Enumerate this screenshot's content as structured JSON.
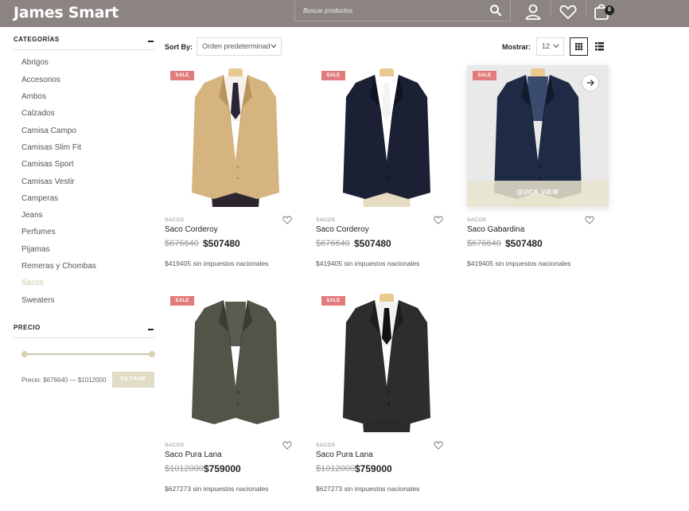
{
  "header": {
    "logo": "James Smart",
    "search_placeholder": "Buscar productos",
    "cart_count": "0"
  },
  "sidebar": {
    "categories_title": "CATEGORÍAS",
    "categories": [
      {
        "label": "Abrigos"
      },
      {
        "label": "Accesorios"
      },
      {
        "label": "Ambos"
      },
      {
        "label": "Calzados"
      },
      {
        "label": "Camisa Campo"
      },
      {
        "label": "Camisas Slim Fit"
      },
      {
        "label": "Camisas Sport"
      },
      {
        "label": "Camisas Vestir"
      },
      {
        "label": "Camperas"
      },
      {
        "label": "Jeans"
      },
      {
        "label": "Perfumes"
      },
      {
        "label": "Pijamas"
      },
      {
        "label": "Remeras y Chombas"
      },
      {
        "label": "Sacos",
        "active": true
      },
      {
        "label": "Sweaters"
      }
    ],
    "price_title": "PRECIO",
    "price_range": "Precio: $676640 — $1012000",
    "filter_label": "FILTRAR",
    "slider_min": 0,
    "slider_max": 1
  },
  "toolbar": {
    "sort_label": "Sort By:",
    "sort_value": "Orden predeterminado",
    "show_label": "Mostrar:",
    "show_value": "12"
  },
  "products": [
    {
      "badge": "SALE",
      "category": "SACOS",
      "name": "Saco Corderoy",
      "old_price": "$676640",
      "price": "$507480",
      "tax_note": "$419405 sin impuestos nacionales",
      "style": "tan"
    },
    {
      "badge": "SALE",
      "category": "SACOS",
      "name": "Saco Corderoy",
      "old_price": "$676640",
      "price": "$507480",
      "tax_note": "$419405 sin impuestos nacionales",
      "style": "navy"
    },
    {
      "badge": "SALE",
      "category": "SACOS",
      "name": "Saco Gabardina",
      "old_price": "$676640",
      "price": "$507480",
      "tax_note": "$419405 sin impuestos nacionales",
      "style": "navy2",
      "quick_view": "QUICK VIEW"
    },
    {
      "badge": "SALE",
      "category": "SACOS",
      "name": "Saco Pura Lana",
      "old_price": "$1012000",
      "price": "$759000",
      "tax_note": "$627273 sin impuestos nacionales",
      "style": "olive"
    },
    {
      "badge": "SALE",
      "category": "SACOS",
      "name": "Saco Pura Lana",
      "old_price": "$1012000",
      "price": "$759000",
      "tax_note": "$627273 sin impuestos nacionales",
      "style": "charcoal"
    }
  ],
  "colors": {
    "header_bg": "#8c8482",
    "accent": "#cfc7a4",
    "sale_badge": "#e27c7c"
  }
}
